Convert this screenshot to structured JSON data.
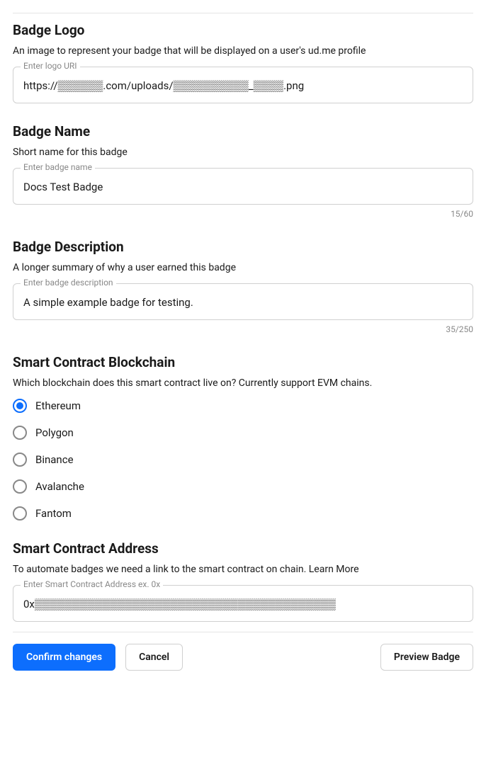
{
  "badge_logo": {
    "title": "Badge Logo",
    "subtitle": "An image to represent your badge that will be displayed on a user's ud.me profile",
    "legend": "Enter logo URI",
    "value": "https://▒▒▒▒▒▒.com/uploads/▒▒▒▒▒▒▒▒▒▒_▒▒▒▒.png"
  },
  "badge_name": {
    "title": "Badge Name",
    "subtitle": "Short name for this badge",
    "legend": "Enter badge name",
    "value": "Docs Test Badge",
    "counter": "15/60"
  },
  "badge_description": {
    "title": "Badge Description",
    "subtitle": "A longer summary of why a user earned this badge",
    "legend": "Enter badge description",
    "value": "A simple example badge for testing.",
    "counter": "35/250"
  },
  "blockchain": {
    "title": "Smart Contract Blockchain",
    "subtitle": "Which blockchain does this smart contract live on? Currently support EVM chains.",
    "options": [
      "Ethereum",
      "Polygon",
      "Binance",
      "Avalanche",
      "Fantom"
    ],
    "selected_index": 0
  },
  "contract_address": {
    "title": "Smart Contract Address",
    "subtitle_pre": "To automate badges we need a link to the smart contract on chain. ",
    "learn_more": "Learn More",
    "legend": "Enter Smart Contract Address ex. 0x",
    "value": "0x▒▒▒▒▒▒▒▒▒▒▒▒▒▒▒▒▒▒▒▒▒▒▒▒▒▒▒▒▒▒▒▒▒▒▒▒▒▒▒▒"
  },
  "buttons": {
    "confirm": "Confirm changes",
    "cancel": "Cancel",
    "preview": "Preview Badge"
  }
}
